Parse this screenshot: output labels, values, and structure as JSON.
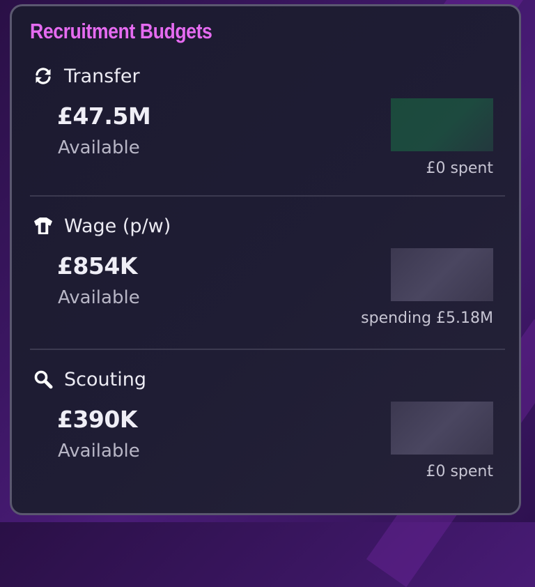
{
  "panel": {
    "title": "Recruitment Budgets"
  },
  "budgets": [
    {
      "label": "Transfer",
      "icon": "refresh-icon",
      "amount": "£47.5M",
      "available_label": "Available",
      "spent_text": "£0 spent",
      "bar_color": "#1b4a3c"
    },
    {
      "label": "Wage (p/w)",
      "icon": "shirt-icon",
      "amount": "£854K",
      "available_label": "Available",
      "spent_text": "spending £5.18M",
      "bar_color": "#45415a"
    },
    {
      "label": "Scouting",
      "icon": "search-icon",
      "amount": "£390K",
      "available_label": "Available",
      "spent_text": "£0 spent",
      "bar_color": "#45415a"
    }
  ],
  "colors": {
    "title_accent": "#e56bf0",
    "panel_bg": "#1f1d34",
    "panel_border": "#5b5870",
    "text_primary": "#ecebf3",
    "text_secondary": "#b8b6c6"
  }
}
